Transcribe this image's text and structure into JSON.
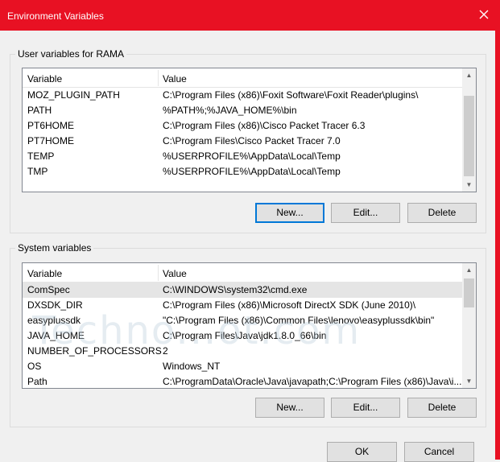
{
  "window": {
    "title": "Environment Variables"
  },
  "user_vars": {
    "group_label": "User variables for RAMA",
    "columns": [
      "Variable",
      "Value"
    ],
    "rows": [
      {
        "variable": "MOZ_PLUGIN_PATH",
        "value": "C:\\Program Files (x86)\\Foxit Software\\Foxit Reader\\plugins\\"
      },
      {
        "variable": "PATH",
        "value": "%PATH%;%JAVA_HOME%\\bin"
      },
      {
        "variable": "PT6HOME",
        "value": "C:\\Program Files (x86)\\Cisco Packet Tracer 6.3"
      },
      {
        "variable": "PT7HOME",
        "value": "C:\\Program Files\\Cisco Packet Tracer 7.0"
      },
      {
        "variable": "TEMP",
        "value": "%USERPROFILE%\\AppData\\Local\\Temp"
      },
      {
        "variable": "TMP",
        "value": "%USERPROFILE%\\AppData\\Local\\Temp"
      }
    ],
    "buttons": {
      "new": "New...",
      "edit": "Edit...",
      "delete": "Delete"
    }
  },
  "system_vars": {
    "group_label": "System variables",
    "columns": [
      "Variable",
      "Value"
    ],
    "rows": [
      {
        "variable": "ComSpec",
        "value": "C:\\WINDOWS\\system32\\cmd.exe",
        "selected": true
      },
      {
        "variable": "DXSDK_DIR",
        "value": "C:\\Program Files (x86)\\Microsoft DirectX SDK (June 2010)\\"
      },
      {
        "variable": "easyplussdk",
        "value": "\"C:\\Program Files (x86)\\Common Files\\lenovo\\easyplussdk\\bin\""
      },
      {
        "variable": "JAVA_HOME",
        "value": "C:\\Program Files\\Java\\jdk1.8.0_66\\bin"
      },
      {
        "variable": "NUMBER_OF_PROCESSORS",
        "value": "2"
      },
      {
        "variable": "OS",
        "value": "Windows_NT"
      },
      {
        "variable": "Path",
        "value": "C:\\ProgramData\\Oracle\\Java\\javapath;C:\\Program Files (x86)\\Java\\i..."
      }
    ],
    "buttons": {
      "new": "New...",
      "edit": "Edit...",
      "delete": "Delete"
    }
  },
  "dialog_buttons": {
    "ok": "OK",
    "cancel": "Cancel"
  },
  "watermark": "Techno...ot.com",
  "colors": {
    "titlebar": "#e81123",
    "focus_border": "#0078d7"
  }
}
